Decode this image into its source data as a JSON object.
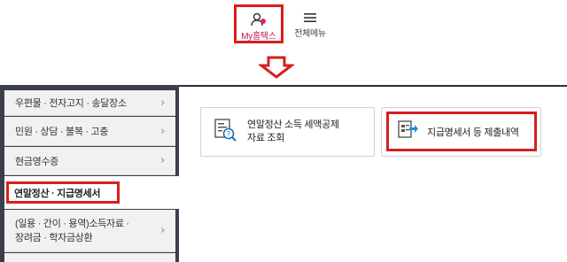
{
  "header": {
    "my_hometax_label": "My홈택스",
    "all_menu_label": "전체메뉴",
    "my_hometax_icon": "user-icon",
    "all_menu_icon": "hamburger-menu-icon",
    "highlight_color": "#d81e1e"
  },
  "sidebar": {
    "items": [
      {
        "label": "우편물 · 전자고지 · 송달장소"
      },
      {
        "label": "민원 · 상담 · 불복 · 고충"
      },
      {
        "label": "현금영수증"
      },
      {
        "label": "연말정산 · 지급명세서",
        "active": true
      },
      {
        "label_line1": "(일용 · 간이 · 용역)소득자료 ·",
        "label_line2": "장려금 · 학자금상환"
      }
    ],
    "chevron": "›",
    "bg_color": "#3b3f4c"
  },
  "cards": [
    {
      "line1": "연말정산 소득 세액공제",
      "line2": "자료 조회",
      "icon": "document-search-icon"
    },
    {
      "label": "지급명세서 등 제출내역",
      "icon": "document-submit-icon"
    }
  ]
}
